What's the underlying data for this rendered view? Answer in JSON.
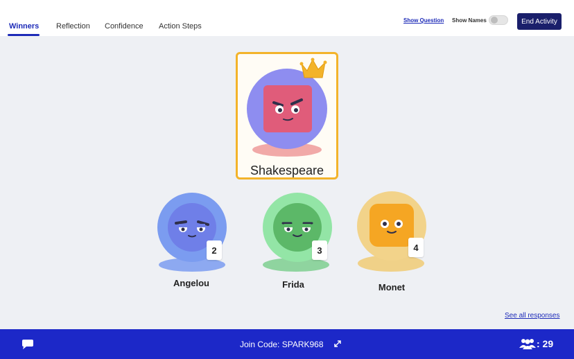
{
  "tabs": [
    {
      "label": "Winners",
      "active": true
    },
    {
      "label": "Reflection",
      "active": false
    },
    {
      "label": "Confidence",
      "active": false
    },
    {
      "label": "Action Steps",
      "active": false
    }
  ],
  "header": {
    "show_question": "Show Question",
    "show_names": "Show Names",
    "show_names_enabled": false,
    "end_activity": "End Activity"
  },
  "winner": {
    "name": "Shakespeare",
    "icon": "crown-icon",
    "avatar_color": "#8e8df0",
    "face_color": "#e05c7a"
  },
  "runners_up": [
    {
      "name": "Angelou",
      "rank": "2",
      "avatar_color": "#7b9cf0",
      "face_color": "#6f7fe8"
    },
    {
      "name": "Frida",
      "rank": "3",
      "avatar_color": "#93e5a6",
      "face_color": "#5cb868"
    },
    {
      "name": "Monet",
      "rank": "4",
      "avatar_color": "#f2d38a",
      "face_color": "#f5a623"
    }
  ],
  "see_all": "See all responses",
  "footer": {
    "join_code": "Join Code: SPARK968",
    "participant_count": ": 29"
  },
  "colors": {
    "accent": "#1c28c8",
    "winner_border": "#f3b32a",
    "end_button": "#1a1f6b"
  }
}
